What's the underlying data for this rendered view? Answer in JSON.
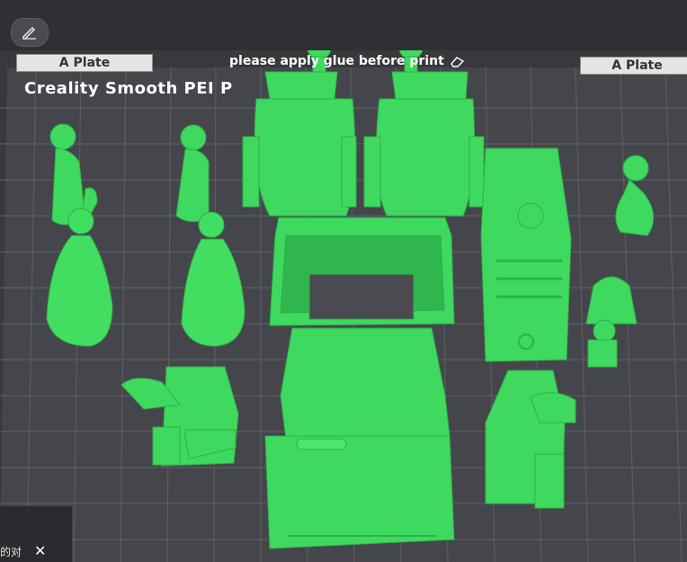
{
  "plate": {
    "tab_left": "A Plate",
    "tab_right": "A Plate",
    "note": "please apply glue before print",
    "bed_label": "Creality Smooth PEI P"
  },
  "toast": {
    "text": "的对",
    "close": "✕"
  },
  "colors": {
    "model": "#3fd95f",
    "grid": "#5a5b60",
    "bed": "#45464b",
    "background": "#38393d"
  },
  "icons": {
    "edit": "pencil-icon",
    "note": "eraser-icon"
  }
}
